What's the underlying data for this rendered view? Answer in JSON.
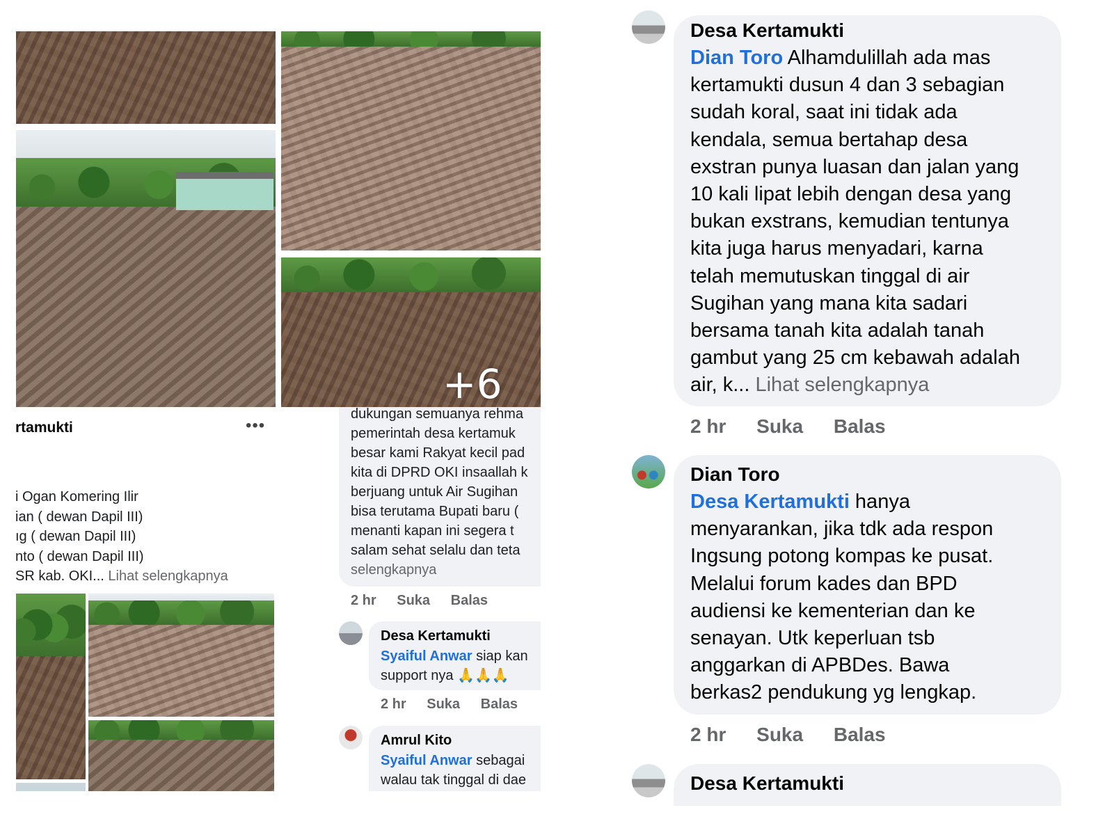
{
  "left_post": {
    "author_partial": "rtamukti",
    "more_icon": "more-horizontal-icon",
    "plus_count": "+6",
    "lines": [
      "i Ogan Komering Ilir",
      "ian ( dewan Dapil III)",
      "ıg ( dewan Dapil III)",
      "nto ( dewan Dapil III)"
    ],
    "last_line": "SR kab. OKI...",
    "see_more": "Lihat selengkapnya"
  },
  "middle_thread": {
    "reply_lines": [
      "dukungan semuanya rehma",
      "pemerintah desa  kertamuk",
      "besar kami Rakyat kecil pad",
      "kita di DPRD OKI insaallah k",
      "berjuang  untuk Air Sugihan",
      "bisa  terutama Bupati baru (",
      "menanti   kapan ini segera t",
      "salam sehat selalu dan teta"
    ],
    "reply_see_more": "selengkapnya",
    "reply_meta": {
      "time": "2 hr",
      "like": "Suka",
      "reply": "Balas"
    },
    "comment1": {
      "name": "Desa Kertamukti",
      "mention": "Syaiful Anwar",
      "text_rest": " siap kan",
      "line2": "support nya 🙏🙏🙏",
      "meta": {
        "time": "2 hr",
        "like": "Suka",
        "reply": "Balas"
      }
    },
    "comment2": {
      "name": "Amrul Kito",
      "mention": "Syaiful Anwar",
      "text_rest": " sebagai",
      "line2": "walau tak tinggal di dae"
    }
  },
  "right_thread": {
    "comment1": {
      "name": "Desa Kertamukti",
      "mention": "Dian Toro",
      "first_line_rest": " Alhamdulillah ada mas",
      "lines": [
        "kertamukti dusun 4 dan 3 sebagian",
        "sudah koral, saat ini tidak ada",
        "kendala, semua bertahap desa",
        "exstran punya luasan dan jalan yang",
        "10 kali lipat lebih dengan desa yang",
        "bukan exstrans, kemudian tentunya",
        "kita juga harus menyadari, karna",
        "telah memutuskan tinggal di air",
        "Sugihan yang mana kita sadari",
        "bersama tanah kita adalah tanah",
        "gambut yang 25 cm kebawah adalah"
      ],
      "last_line": "air, k...",
      "see_more": "Lihat selengkapnya",
      "meta": {
        "time": "2 hr",
        "like": "Suka",
        "reply": "Balas"
      }
    },
    "comment2": {
      "name": "Dian Toro",
      "mention": "Desa Kertamukti",
      "first_line_rest": " hanya",
      "lines": [
        "menyarankan, jika tdk ada respon",
        "Ingsung potong kompas ke pusat.",
        "Melalui forum kades dan BPD",
        "audiensi ke kementerian dan ke",
        "senayan. Utk keperluan tsb",
        "anggarkan di APBDes. Bawa",
        "berkas2 pendukung yg lengkap."
      ],
      "meta": {
        "time": "2 hr",
        "like": "Suka",
        "reply": "Balas"
      }
    },
    "comment3": {
      "name": "Desa Kertamukti"
    }
  }
}
